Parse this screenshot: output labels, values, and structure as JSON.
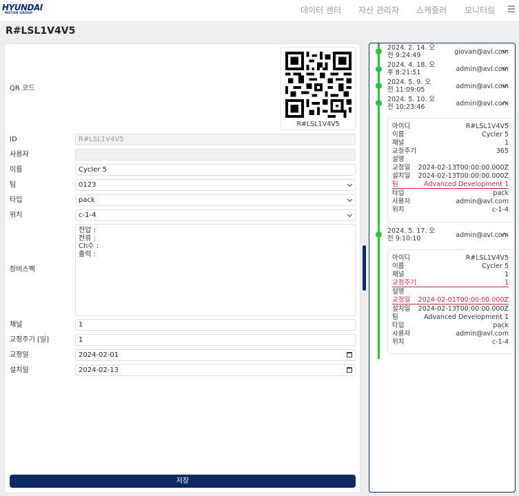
{
  "brand": {
    "name": "HYUNDAI",
    "sub": "MOTOR GROUP"
  },
  "nav": [
    "데이터 센터",
    "자산 관리자",
    "스케줄러",
    "모니터링"
  ],
  "title": "R#LSL1V4V5",
  "form": {
    "qr_label": "QR 코드",
    "qr_caption": "R#LSL1V4V5",
    "labels": {
      "id": "ID",
      "user": "사용자",
      "name": "이름",
      "team": "팀",
      "type": "타입",
      "location": "위치",
      "spec": "장비스펙",
      "channel": "채널",
      "calib_period": "교정주기 [일]",
      "calib_date": "교정일",
      "install_date": "설치일"
    },
    "values": {
      "id": "R#LSL1V4V5",
      "user": "",
      "name": "Cycler 5",
      "team": "0123",
      "type": "pack",
      "location": "c-1-4",
      "channel": "1",
      "calib_period": "1",
      "calib_date": "2024-02-01",
      "install_date": "2024-02-13"
    },
    "spec_lines": [
      "전압 :",
      "전류 :",
      "Ch수 :",
      "출력 :"
    ],
    "save_label": "저장"
  },
  "history": [
    {
      "date1": "2024. 2. 14. 오",
      "date2": "전 9:24:49",
      "user": "giovan@avl.com",
      "expanded": false
    },
    {
      "date1": "2024. 4. 18. 오",
      "date2": "후 8:21:51",
      "user": "admin@avl.com",
      "expanded": false
    },
    {
      "date1": "2024. 5. 9. 오",
      "date2": "전 11:09:05",
      "user": "admin@avl.com",
      "expanded": false
    },
    {
      "date1": "2024. 5. 10. 오",
      "date2": "전 10:23:46",
      "user": "admin@avl.com",
      "expanded": true,
      "rows": [
        {
          "k": "아이디",
          "v": "R#LSL1V4V5"
        },
        {
          "k": "이름",
          "v": "Cycler 5"
        },
        {
          "k": "채널",
          "v": "1"
        },
        {
          "k": "교정주기",
          "v": "365"
        },
        {
          "k": "설명",
          "v": ""
        },
        {
          "k": "교정일",
          "v": "2024-02-13T00:00:00.000Z"
        },
        {
          "k": "설치일",
          "v": "2024-02-13T00:00:00.000Z"
        },
        {
          "k": "팀",
          "v": "Advanced Development 1",
          "changed": true
        },
        {
          "k": "타입",
          "v": "pack"
        },
        {
          "k": "사용자",
          "v": "admin@avl.com"
        },
        {
          "k": "위치",
          "v": "c-1-4"
        }
      ]
    },
    {
      "date1": "2024. 5. 17. 오",
      "date2": "전 9:10:10",
      "user": "admin@avl.com",
      "expanded": true,
      "rows": [
        {
          "k": "아이디",
          "v": "R#LSL1V4V5"
        },
        {
          "k": "이름",
          "v": "Cycler 5"
        },
        {
          "k": "채널",
          "v": "1"
        },
        {
          "k": "교정주기",
          "v": "1",
          "changed": true
        },
        {
          "k": "설명",
          "v": ""
        },
        {
          "k": "교정일",
          "v": "2024-02-01T00:00:00.000Z",
          "changed": true
        },
        {
          "k": "설치일",
          "v": "2024-02-13T00:00:00.000Z"
        },
        {
          "k": "팀",
          "v": "Advanced Development 1"
        },
        {
          "k": "타입",
          "v": "pack"
        },
        {
          "k": "사용자",
          "v": "admin@avl.com"
        },
        {
          "k": "위치",
          "v": "c-1-4"
        }
      ]
    }
  ]
}
